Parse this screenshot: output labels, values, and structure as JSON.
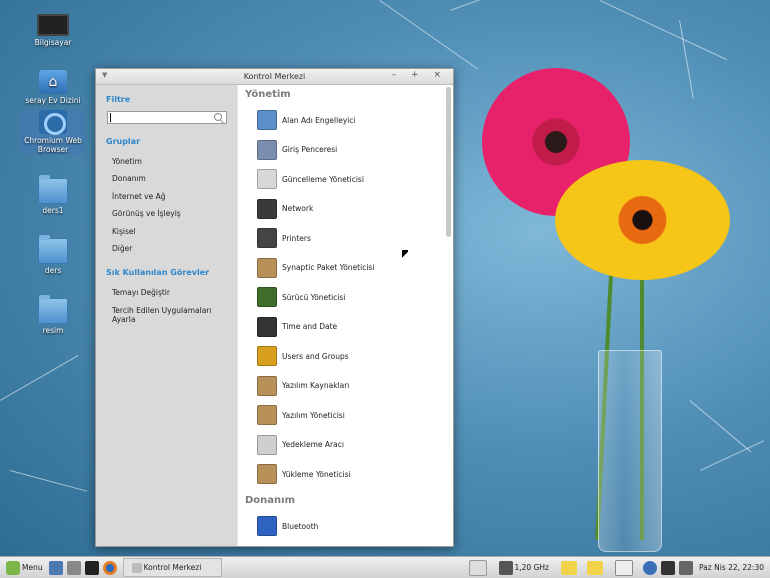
{
  "desktop": {
    "icons": [
      {
        "label": "Bilgisayar"
      },
      {
        "label": "seray Ev Dizini"
      },
      {
        "label": "Chromium Web Browser"
      },
      {
        "label": "ders1"
      },
      {
        "label": "ders"
      },
      {
        "label": "resim"
      }
    ]
  },
  "window": {
    "title": "Kontrol Merkezi",
    "controls": "– + ×"
  },
  "sidebar": {
    "filter_heading": "Filtre",
    "filter_value": "",
    "groups_heading": "Gruplar",
    "groups": [
      "Yönetim",
      "Donanım",
      "İnternet ve Ağ",
      "Görünüş ve İşleyiş",
      "Kişisel",
      "Diğer"
    ],
    "tasks_heading": "Sık Kullanılan Görevler",
    "tasks": [
      "Temayı Değiştir",
      "Tercih Edilen Uygulamaları Ayarla"
    ]
  },
  "content": {
    "sections": [
      {
        "title": "Yönetim",
        "items": [
          {
            "label": "Alan Adı Engelleyici",
            "icon": "domain-blocker-icon",
            "color": "#5a8fc8"
          },
          {
            "label": "Giriş Penceresi",
            "icon": "login-window-icon",
            "color": "#7a8fb0"
          },
          {
            "label": "Güncelleme Yöneticisi",
            "icon": "update-shield-icon",
            "color": "#d8d8d8"
          },
          {
            "label": "Network",
            "icon": "network-icon",
            "color": "#3a3a3a"
          },
          {
            "label": "Printers",
            "icon": "printer-icon",
            "color": "#444444"
          },
          {
            "label": "Synaptic Paket Yöneticisi",
            "icon": "package-icon",
            "color": "#b8905a"
          },
          {
            "label": "Sürücü Yöneticisi",
            "icon": "driver-chip-icon",
            "color": "#3f6e2b"
          },
          {
            "label": "Time and Date",
            "icon": "clock-icon",
            "color": "#333333"
          },
          {
            "label": "Users and Groups",
            "icon": "users-icon",
            "color": "#d9a020"
          },
          {
            "label": "Yazılım Kaynakları",
            "icon": "software-sources-icon",
            "color": "#b8905a"
          },
          {
            "label": "Yazılım Yöneticisi",
            "icon": "software-manager-icon",
            "color": "#b8905a"
          },
          {
            "label": "Yedekleme Aracı",
            "icon": "backup-icon",
            "color": "#cfcfcf"
          },
          {
            "label": "Yükleme Yöneticisi",
            "icon": "upload-manager-icon",
            "color": "#b8905a"
          }
        ]
      },
      {
        "title": "Donanım",
        "items": [
          {
            "label": "Bluetooth",
            "icon": "bluetooth-icon",
            "color": "#2f63c2"
          }
        ]
      }
    ]
  },
  "taskbar": {
    "menu_label": "Menu",
    "task_label": "Kontrol Merkezi",
    "cpu_freq": "1,20 GHz",
    "clock": "Paz Nis 22, 22:30"
  }
}
